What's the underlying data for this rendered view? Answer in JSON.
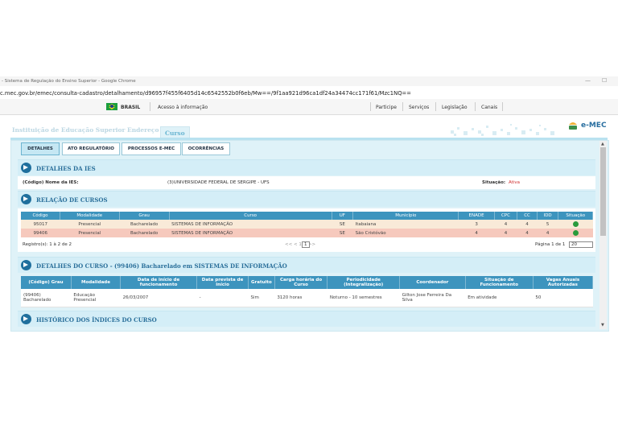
{
  "browser": {
    "window_title": "- Sistema de Regulação do Ensino Superior - Google Chrome",
    "url": "c.mec.gov.br/emec/consulta-cadastro/detalhamento/d96957f455f6405d14c6542552b0f6eb/Mw==/9f1aa921d96ca1df24a34474cc171f61/Mzc1NQ=="
  },
  "govbar": {
    "brasil": "BRASIL",
    "acesso": "Acesso à informação",
    "links": [
      "Participe",
      "Serviços",
      "Legislação",
      "Canais"
    ]
  },
  "logo": {
    "text": "e-MEC"
  },
  "tabs": [
    "Instituição de Educação Superior",
    "Endereço",
    "Curso"
  ],
  "subtabs": [
    "DETALHES",
    "ATO REGULATÓRIO",
    "PROCESSOS E-MEC",
    "OCORRÊNCIAS"
  ],
  "ies": {
    "section_title": "DETALHES DA IES",
    "label": "(Código) Nome da IES:",
    "value": "(3)UNIVERSIDADE FEDERAL DE SERGIPE - UFS",
    "situacao_label": "Situação:",
    "situacao_value": "Ativa"
  },
  "cursos": {
    "section_title": "RELAÇÃO DE CURSOS",
    "headers": [
      "Código",
      "Modalidade",
      "Grau",
      "Curso",
      "UF",
      "Município",
      "ENADE",
      "CPC",
      "CC",
      "IDD",
      "Situação"
    ],
    "rows": [
      [
        "95017",
        "Presencial",
        "Bacharelado",
        "SISTEMAS DE INFORMAÇÃO",
        "SE",
        "Itabaiana",
        "3",
        "4",
        "4",
        "5"
      ],
      [
        "99406",
        "Presencial",
        "Bacharelado",
        "SISTEMAS DE INFORMAÇÃO",
        "SE",
        "São Cristóvão",
        "4",
        "4",
        "4",
        "4"
      ]
    ],
    "records": "Registro(s): 1 à 2 de 2",
    "pager": "<< < 1 > >>",
    "page_select": "1",
    "page_info": "Página 1 de 1",
    "per_page": "20"
  },
  "detalhes": {
    "section_title": "DETALHES DO CURSO - (99406) Bacharelado em SISTEMAS DE INFORMAÇÃO",
    "headers": [
      "(Código) Grau",
      "Modalidade",
      "Data de início de funcionamento",
      "Data prevista de início",
      "Gratuito",
      "Carga horária do Curso",
      "Periodicidade (Integralização)",
      "Coordenador",
      "Situação de Funcionamento",
      "Vagas Anuais Autorizadas"
    ],
    "row": [
      "(99406) Bacharelado",
      "Educação Presencial",
      "26/03/2007",
      "-",
      "Sim",
      "3120 horas",
      "Noturno - 10 semestres",
      "Gilton Jose Ferreira Da Silva",
      "Em atividade",
      "50"
    ]
  },
  "historico": {
    "section_title": "HISTÓRICO DOS ÍNDICES DO CURSO"
  },
  "colors": {
    "header_blue": "#3d94be",
    "panel_bg": "#dff2f8",
    "row_highlight": "#f6c9bd",
    "active_status": "#d03030"
  }
}
